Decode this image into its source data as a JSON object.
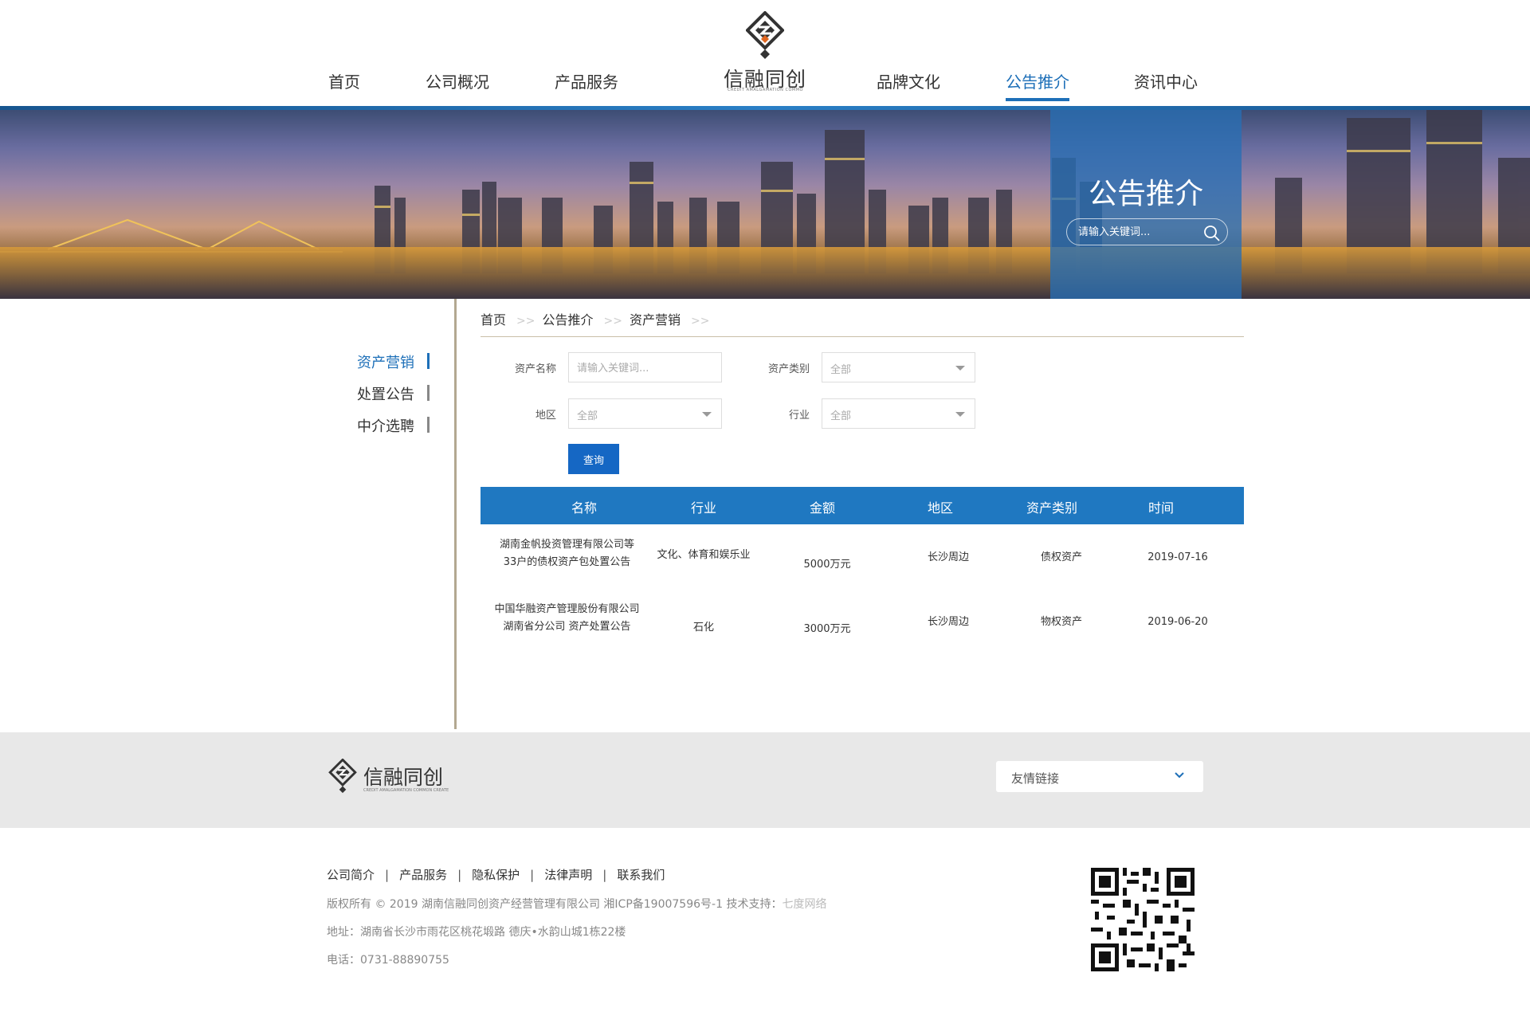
{
  "header": {
    "nav_left": [
      "首页",
      "公司概况",
      "产品服务"
    ],
    "nav_right": [
      "品牌文化",
      "公告推介",
      "资讯中心"
    ],
    "active_nav": "公告推介",
    "logo_text": "信融同创",
    "logo_subtext": "CREDIT AMALGAMATION COMMON CREATE",
    "accent_color": "#1d6fb8"
  },
  "banner": {
    "title": "公告推介",
    "search_placeholder": "请输入关键词..."
  },
  "sidebar": {
    "items": [
      "资产营销",
      "处置公告",
      "中介选聘"
    ],
    "active": "资产营销"
  },
  "breadcrumb": [
    "首页",
    "公告推介",
    "资产营销"
  ],
  "filter_form": {
    "asset_name_label": "资产名称",
    "asset_name_placeholder": "请输入关键词...",
    "asset_type_label": "资产类别",
    "asset_type_value": "全部",
    "region_label": "地区",
    "region_value": "全部",
    "industry_label": "行业",
    "industry_value": "全部",
    "query_button": "查询"
  },
  "table": {
    "columns": [
      "名称",
      "行业",
      "金额",
      "地区",
      "资产类别",
      "时间"
    ],
    "rows": [
      {
        "name": "湖南金帆投资管理有限公司等33户的债权资产包处置公告",
        "industry": "文化、体育和娱乐业",
        "amount": "5000万元",
        "region": "长沙周边",
        "asset_type": "债权资产",
        "date": "2019-07-16"
      },
      {
        "name": "中国华融资产管理股份有限公司湖南省分公司 资产处置公告",
        "industry": "石化",
        "amount": "3000万元",
        "region": "长沙周边",
        "asset_type": "物权资产",
        "date": "2019-06-20"
      }
    ]
  },
  "footer": {
    "logo_text": "信融同创",
    "logo_subtext": "CREDIT AMALGAMATION COMMON CREATE",
    "friend_links_label": "友情链接",
    "links": [
      "公司简介",
      "产品服务",
      "隐私保护",
      "法律声明",
      "联系我们"
    ],
    "copyright": "版权所有 © 2019 湖南信融同创资产经营管理有限公司 湘ICP备19007596号-1 技术支持：",
    "tech_support": "七度网络",
    "address": "地址：湖南省长沙市雨花区桃花塅路 德庆•水韵山城1栋22楼",
    "phone": "电话：0731-88890755"
  }
}
